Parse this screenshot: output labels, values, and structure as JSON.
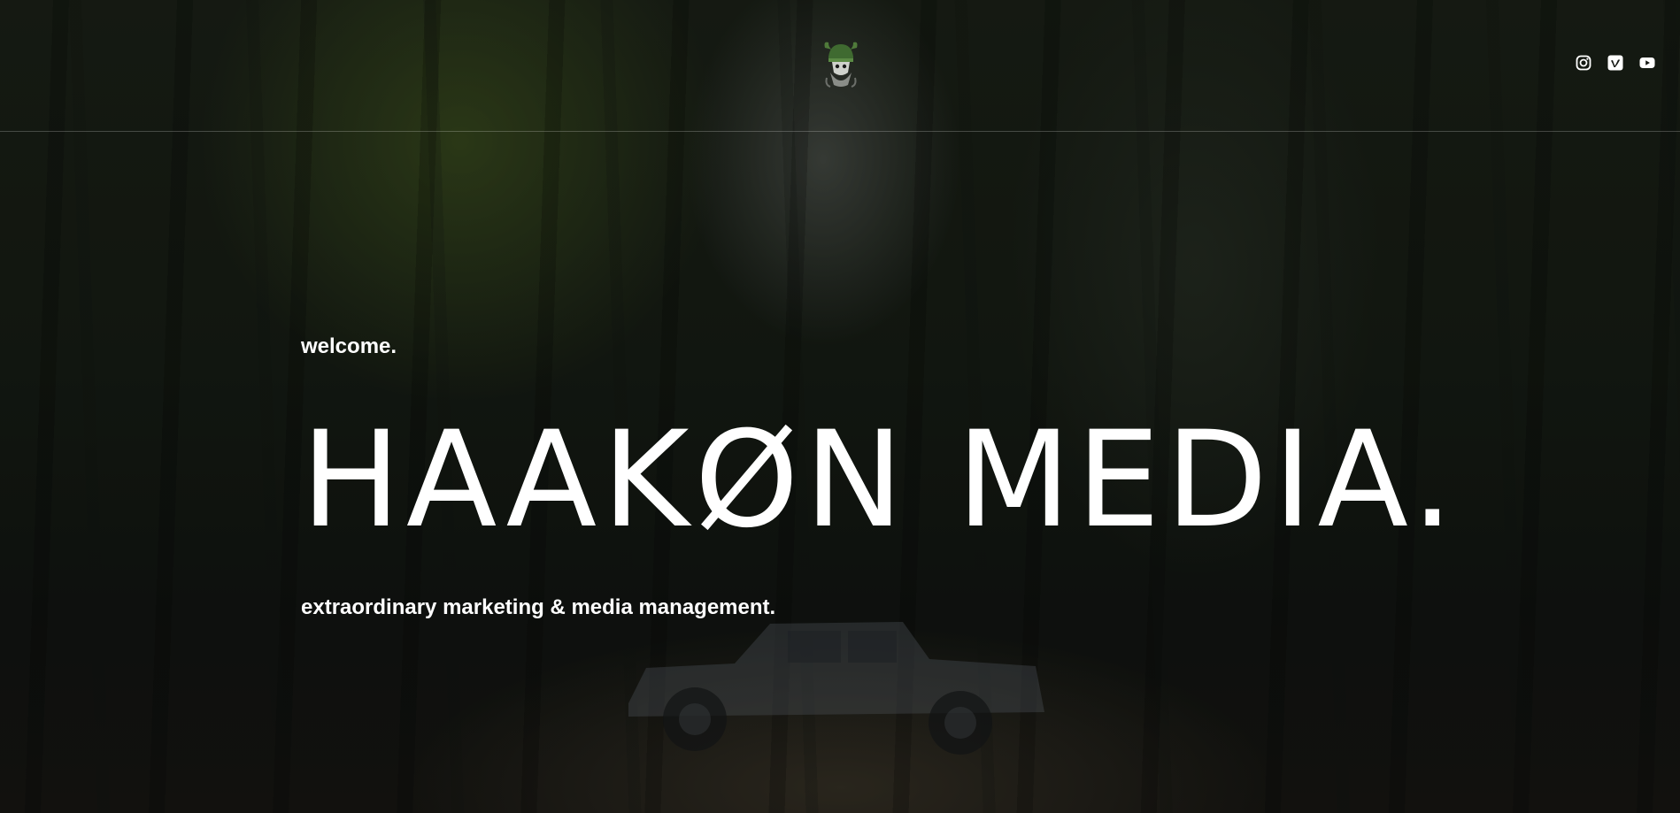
{
  "header": {
    "logo_icon": "viking-helmet-logo-icon",
    "social": [
      {
        "name": "instagram",
        "icon": "instagram-icon"
      },
      {
        "name": "vimeo",
        "icon": "vimeo-icon"
      },
      {
        "name": "youtube",
        "icon": "youtube-icon"
      }
    ]
  },
  "hero": {
    "welcome": "welcome.",
    "title": "HAAKØN MEDIA.",
    "tagline": "extraordinary marketing & media management."
  },
  "colors": {
    "text": "#ffffff",
    "logo_green": "#4f7a3a",
    "background": "#1a2118"
  }
}
